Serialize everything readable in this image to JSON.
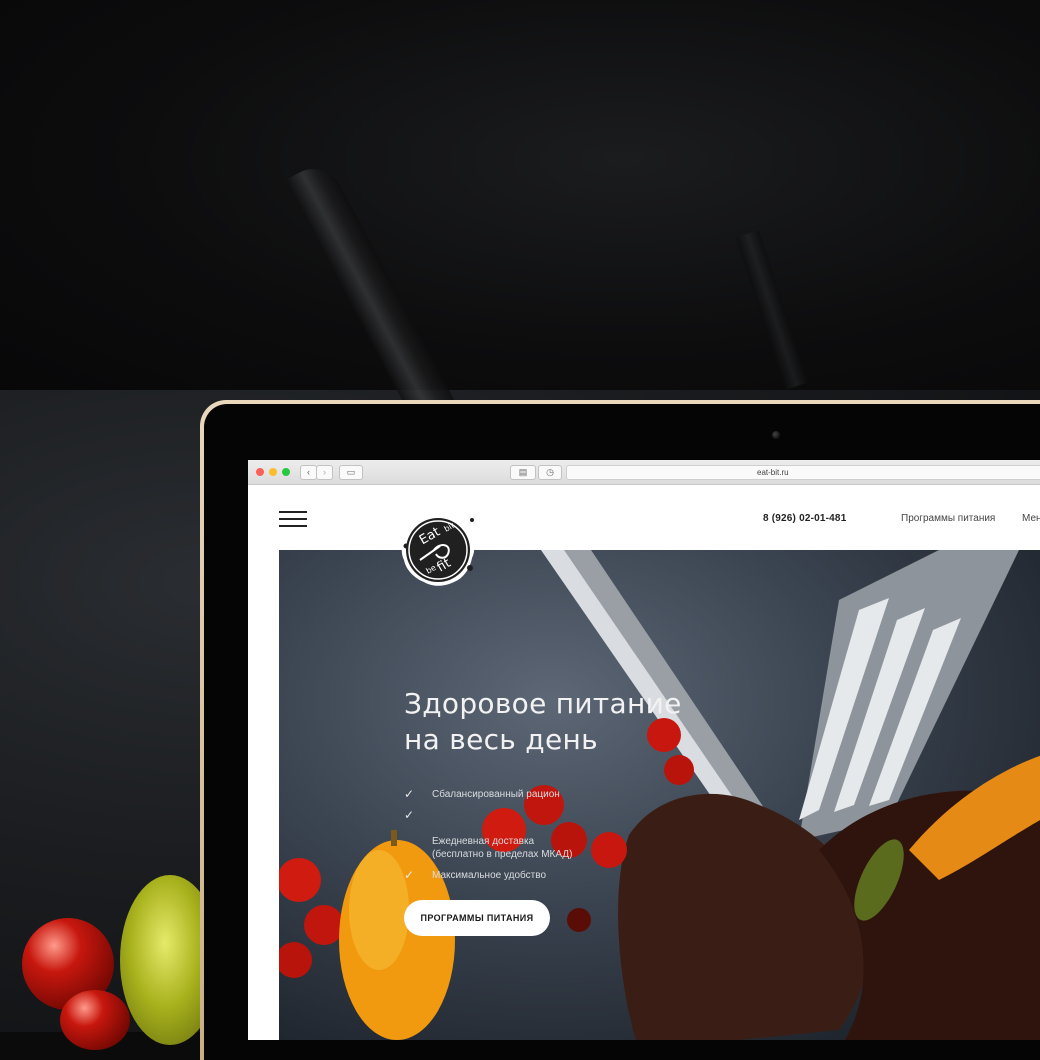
{
  "browser": {
    "url": "eat-bit.ru"
  },
  "site": {
    "logo": {
      "line1": "Eat",
      "line1_small": "bit",
      "line2_small": "be",
      "line2": "fit"
    },
    "phone": "8 (926) 02-01-481",
    "nav": [
      "Программы питания",
      "Мен"
    ],
    "hero": {
      "title_line1": "Здоровое питание",
      "title_line2": "на весь день",
      "features": [
        "Сбалансированный рацион",
        "Ежедневная доставка\n(бесплатно в пределах МКАД)",
        "Максимальное удобство"
      ],
      "cta": "ПРОГРАММЫ ПИТАНИЯ"
    }
  },
  "icons": {
    "menu": "hamburger-icon",
    "check": "check-icon",
    "back": "chevron-left-icon",
    "forward": "chevron-right-icon",
    "sidebar": "sidebar-icon",
    "reader": "reader-icon",
    "history": "clock-icon"
  },
  "colors": {
    "frame_gold": "#d9c09a",
    "hero_bg": "#3b4451",
    "cta_bg": "#ffffff"
  }
}
